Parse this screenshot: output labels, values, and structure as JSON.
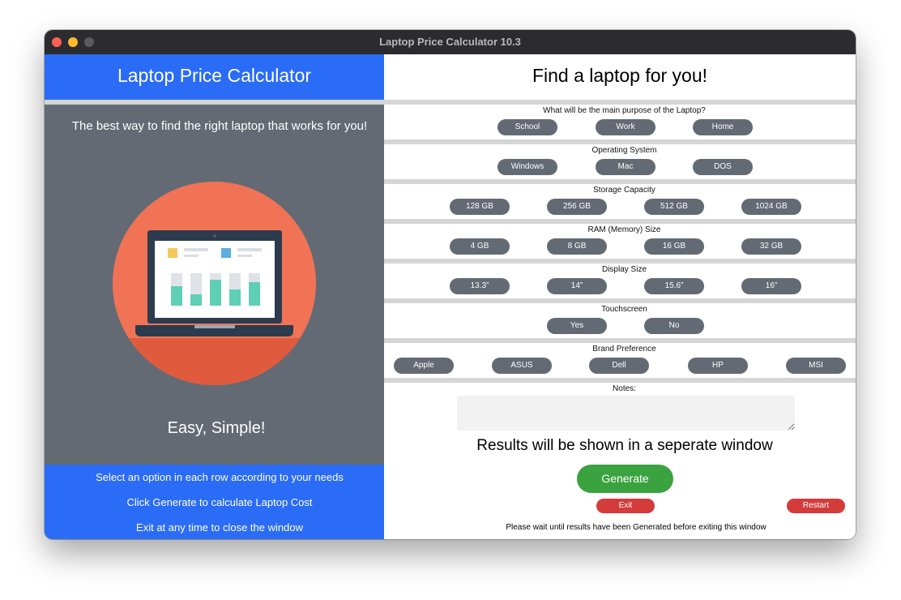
{
  "window": {
    "title": "Laptop Price Calculator 10.3"
  },
  "left": {
    "header": "Laptop Price Calculator",
    "tagline": "The best way to find the right laptop that works for you!",
    "subtitle": "Easy, Simple!",
    "instructions": [
      "Select an option in each row according to your needs",
      "Click Generate to calculate Laptop Cost",
      "Exit at any time to close the window"
    ]
  },
  "right": {
    "header": "Find a laptop for you!",
    "rows": {
      "purpose": {
        "label": "What will be the main purpose of the Laptop?",
        "options": [
          "School",
          "Work",
          "Home"
        ]
      },
      "os": {
        "label": "Operating System",
        "options": [
          "Windows",
          "Mac",
          "DOS"
        ]
      },
      "storage": {
        "label": "Storage Capacity",
        "options": [
          "128 GB",
          "256 GB",
          "512 GB",
          "1024 GB"
        ]
      },
      "ram": {
        "label": "RAM (Memory) Size",
        "options": [
          "4 GB",
          "8 GB",
          "16 GB",
          "32 GB"
        ]
      },
      "display": {
        "label": "Display Size",
        "options": [
          "13.3”",
          "14”",
          "15.6”",
          "16”"
        ]
      },
      "touch": {
        "label": "Touchscreen",
        "options": [
          "Yes",
          "No"
        ]
      },
      "brand": {
        "label": "Brand Preference",
        "options": [
          "Apple",
          "ASUS",
          "Dell",
          "HP",
          "MSI"
        ]
      }
    },
    "notes_label": "Notes:",
    "notes_value": "",
    "results_text": "Results will be shown in a seperate window",
    "generate_label": "Generate",
    "exit_label": "Exit",
    "restart_label": "Restart",
    "wait_text": "Please wait until results have been Generated before exiting this window"
  },
  "colors": {
    "accent_blue": "#2b6cf6",
    "panel_gray": "#636a73",
    "generate_green": "#3aa340",
    "danger_red": "#d43b3b",
    "separator": "#d5d5d5"
  },
  "icons": [
    "laptop-chart-illustration"
  ]
}
